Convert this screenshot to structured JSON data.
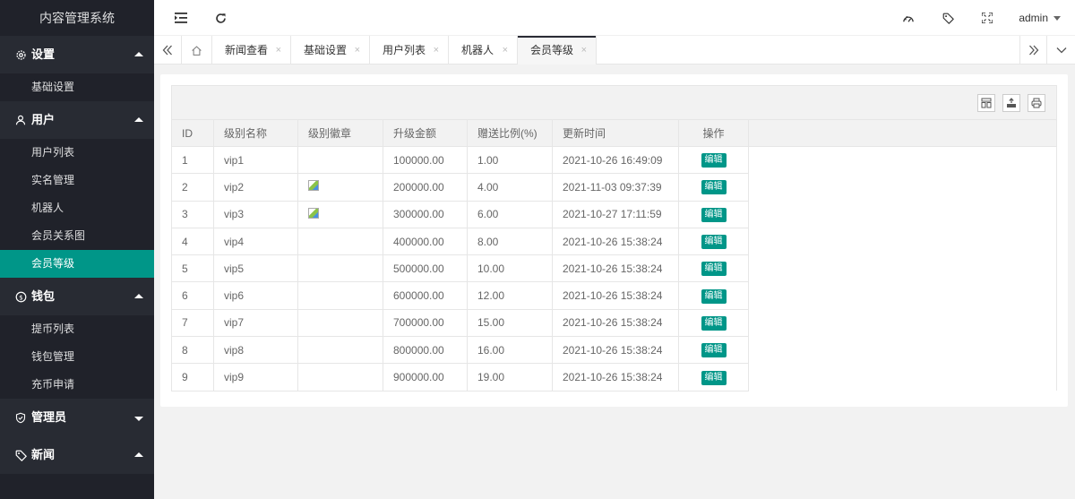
{
  "app": {
    "title": "内容管理系统"
  },
  "sidebar": {
    "groups": [
      {
        "label": "设置",
        "icon": "gear-icon",
        "expanded": true,
        "items": [
          "基础设置"
        ]
      },
      {
        "label": "用户",
        "icon": "user-icon",
        "expanded": true,
        "items": [
          "用户列表",
          "实名管理",
          "机器人",
          "会员关系图",
          "会员等级"
        ]
      },
      {
        "label": "钱包",
        "icon": "coin-icon",
        "expanded": true,
        "items": [
          "提币列表",
          "钱包管理",
          "充币申请"
        ]
      },
      {
        "label": "管理员",
        "icon": "shield-icon",
        "expanded": false,
        "items": []
      },
      {
        "label": "新闻",
        "icon": "tag-icon",
        "expanded": true,
        "items": []
      }
    ],
    "active_item": "会员等级"
  },
  "header": {
    "icons": [
      "menu-toggle-icon",
      "refresh-icon",
      "theme-icon",
      "tag-icon",
      "fullscreen-icon"
    ],
    "user": "admin"
  },
  "tabs": {
    "items": [
      {
        "label": "新闻查看",
        "closable": true
      },
      {
        "label": "基础设置",
        "closable": true
      },
      {
        "label": "用户列表",
        "closable": true
      },
      {
        "label": "机器人",
        "closable": true
      },
      {
        "label": "会员等级",
        "closable": true,
        "active": true
      }
    ],
    "close_glyph": "×"
  },
  "table": {
    "toolbar_icons": [
      "columns-icon",
      "export-icon",
      "print-icon"
    ],
    "columns": [
      "ID",
      "级别名称",
      "级别徽章",
      "升级金额",
      "赠送比例(%)",
      "更新时间",
      "操作"
    ],
    "action_label": "编辑",
    "rows": [
      {
        "id": "1",
        "name": "vip1",
        "badge": false,
        "amount": "100000.00",
        "ratio": "1.00",
        "updated": "2021-10-26 16:49:09"
      },
      {
        "id": "2",
        "name": "vip2",
        "badge": true,
        "amount": "200000.00",
        "ratio": "4.00",
        "updated": "2021-11-03 09:37:39"
      },
      {
        "id": "3",
        "name": "vip3",
        "badge": true,
        "amount": "300000.00",
        "ratio": "6.00",
        "updated": "2021-10-27 17:11:59"
      },
      {
        "id": "4",
        "name": "vip4",
        "badge": false,
        "amount": "400000.00",
        "ratio": "8.00",
        "updated": "2021-10-26 15:38:24"
      },
      {
        "id": "5",
        "name": "vip5",
        "badge": false,
        "amount": "500000.00",
        "ratio": "10.00",
        "updated": "2021-10-26 15:38:24"
      },
      {
        "id": "6",
        "name": "vip6",
        "badge": false,
        "amount": "600000.00",
        "ratio": "12.00",
        "updated": "2021-10-26 15:38:24"
      },
      {
        "id": "7",
        "name": "vip7",
        "badge": false,
        "amount": "700000.00",
        "ratio": "15.00",
        "updated": "2021-10-26 15:38:24"
      },
      {
        "id": "8",
        "name": "vip8",
        "badge": false,
        "amount": "800000.00",
        "ratio": "16.00",
        "updated": "2021-10-26 15:38:24"
      },
      {
        "id": "9",
        "name": "vip9",
        "badge": false,
        "amount": "900000.00",
        "ratio": "19.00",
        "updated": "2021-10-26 15:38:24"
      }
    ]
  },
  "colors": {
    "sidebar_bg": "#20222a",
    "accent": "#009688",
    "header_bg": "#ffffff"
  }
}
